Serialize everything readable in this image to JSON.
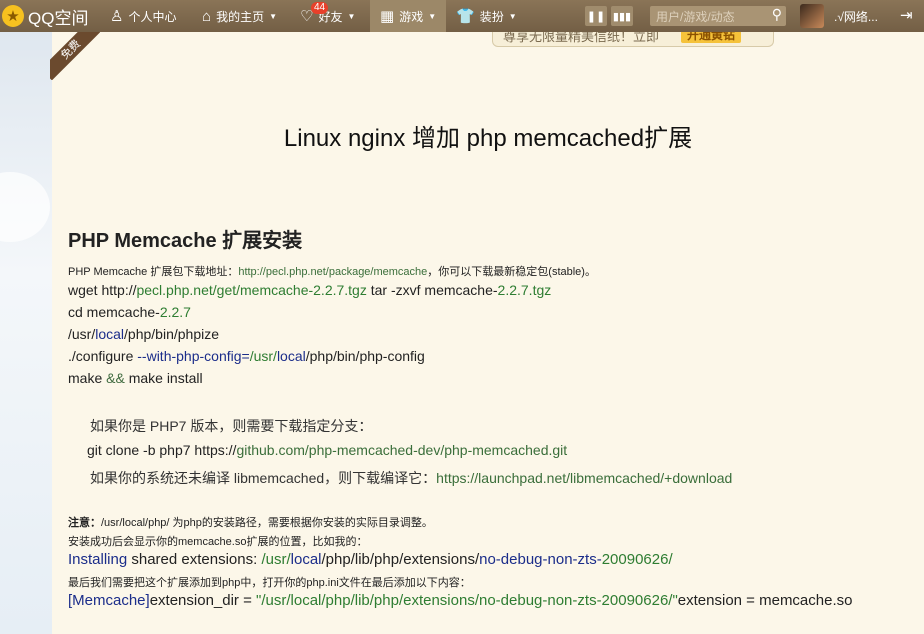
{
  "topbar": {
    "logo_text": "QQ空间",
    "nav": {
      "profile": "个人中心",
      "home": "我的主页",
      "friends": "好友",
      "friends_badge": "44",
      "games": "游戏",
      "decorate": "装扮"
    },
    "search_placeholder": "用户/游戏/动态",
    "user_name": ".√网络..."
  },
  "promo": {
    "text": "尊享无限量精美信纸！立即",
    "button": "开通黄钻"
  },
  "ribbon": "免费",
  "article": {
    "title": "Linux nginx 增加 php memcached扩展",
    "section_title": "PHP Memcache 扩展安装",
    "download_prefix": "PHP Memcache 扩展包下载地址：",
    "download_link": "http://pecl.php.net/package/memcache",
    "download_suffix": "，你可以下载最新稳定包(stable)。",
    "cmd_wget_a": "wget http://",
    "cmd_wget_b": "pecl.php.net/get/memcache-2.2.7.tgz",
    "cmd_wget_c": " tar -zxvf memcache-",
    "cmd_wget_d": "2.2.7.tgz",
    "cmd_cd_a": " cd memcache-",
    "cmd_cd_b": "2.2.7",
    "cmd_phpize_a": " /usr/",
    "cmd_phpize_b": "local",
    "cmd_phpize_c": "/php/bin/phpize",
    "cmd_configure_a": "./configure ",
    "cmd_configure_b": "--with-php-config=",
    "cmd_configure_c": "/usr/",
    "cmd_configure_d": "local",
    "cmd_configure_e": "/php/bin/php-config",
    "cmd_make_a": "make ",
    "cmd_make_b": "&&",
    "cmd_make_c": " make install",
    "php7_note": "如果你是 PHP7 版本，则需要下载指定分支：",
    "git_clone_a": "git clone -b php7 https://",
    "git_clone_b": "github.com/php-memcached-dev/php-memcached.git",
    "lib_note_a": "如果你的系统还未编译 libmemcached，则下载编译它：",
    "lib_note_b": "https://launchpad.net/libmemcached/+download",
    "note_label": "注意：",
    "note_text": "/usr/local/php/ 为php的安装路径，需要根据你安装的实际目录调整。",
    "after_install": "安装成功后会显示你的memcache.so扩展的位置，比如我的：",
    "installing_a": "Installing",
    "installing_b": " shared extensions: ",
    "installing_c": "/usr/",
    "installing_d": "local",
    "installing_e": "/php/lib/php/extensions/",
    "installing_f": "no-debug-non-zts-",
    "installing_g": "20090626/",
    "add_ext": "最后我们需要把这个扩展添加到php中，打开你的php.ini文件在最后添加以下内容：",
    "ini_a": "[Memcache]",
    "ini_b": "extension_dir = ",
    "ini_c": "\"/usr/local/php/lib/php/extensions/no-debug-non-zts-20090626/\"",
    "ini_d": "extension = memcache.so"
  },
  "colors": {
    "topbar": "#7f6a4f",
    "paper": "#fcf7e9",
    "link_green": "#3a6e3a",
    "keyword_blue": "#1b2d8a"
  },
  "icons": [
    "star-logo-icon",
    "person-icon",
    "home-icon",
    "heart-icon",
    "grid-icon",
    "shirt-icon",
    "pause-icon",
    "bars-icon",
    "search-icon",
    "exit-icon"
  ]
}
